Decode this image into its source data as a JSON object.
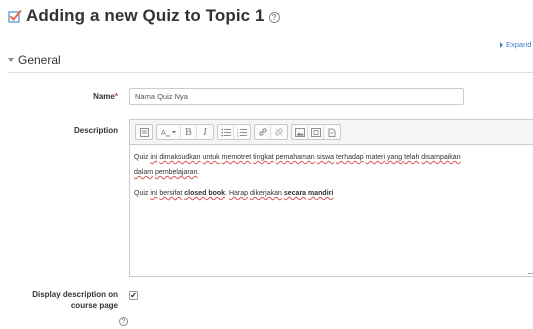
{
  "page": {
    "title": "Adding a new Quiz to Topic 1",
    "help_glyph": "?",
    "expand_all": "Expand al"
  },
  "section": {
    "title": "General"
  },
  "form": {
    "name_label": "Name",
    "required_mark": "*",
    "name_value": "Nama Quiz Nya",
    "description_label": "Description",
    "editor": {
      "toolbar_icons": [
        "collapse-icon",
        "font-style-icon",
        "bold-icon",
        "italic-icon",
        "unordered-list-icon",
        "ordered-list-icon",
        "link-icon",
        "unlink-icon",
        "image-icon",
        "media-icon",
        "file-icon"
      ],
      "bold_glyph": "B",
      "italic_glyph": "I",
      "line1_words": [
        "Quiz ",
        "ini",
        " ",
        "dimaksudkan",
        " ",
        "untuk",
        " ",
        "memotret",
        " ",
        "tingkat",
        " ",
        "pemahaman",
        " ",
        "siswa",
        " ",
        "terhadap",
        " ",
        "materi",
        " yang ",
        "telah",
        " ",
        "disampaikan"
      ],
      "line2_words": [
        "dalam",
        " ",
        "pembelajaran",
        "."
      ],
      "p2_pre": "Quiz ",
      "p2_w1": "ini",
      "p2_w2": "bersifat",
      "p2_bold1": "closed book",
      "p2_mid": ". ",
      "p2_w3": "Harap",
      "p2_w4": "dikerjakan",
      "p2_bold2a": "secara",
      "p2_bold2b": "mandiri"
    },
    "display_desc_label_line1": "Display description on",
    "display_desc_label_line2": "course page",
    "display_desc_checked": true,
    "checkmark": "✔"
  },
  "colors": {
    "link": "#3c87c8",
    "required": "#b94a48",
    "heading_icon": "#4a90d9"
  }
}
